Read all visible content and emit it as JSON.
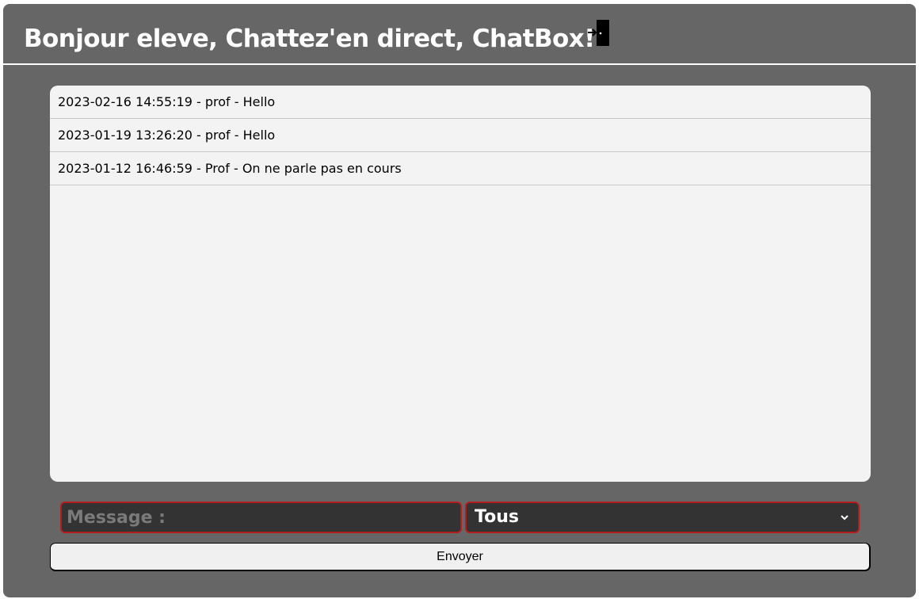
{
  "header": {
    "title": "Bonjour eleve, Chattez'en direct, ChatBox!",
    "logout_icon": "door-exit-icon"
  },
  "messages": [
    "2023-02-16 14:55:19 - prof - Hello",
    "2023-01-19 13:26:20 - prof - Hello",
    "2023-01-12 16:46:59 - Prof - On ne parle pas en cours"
  ],
  "form": {
    "message_placeholder": "Message :",
    "message_value": "",
    "recipient_selected": "Tous",
    "send_label": "Envoyer"
  },
  "colors": {
    "background": "#666666",
    "panel": "#f3f3f3",
    "input_bg": "#333333",
    "input_border": "#b71c1c"
  }
}
